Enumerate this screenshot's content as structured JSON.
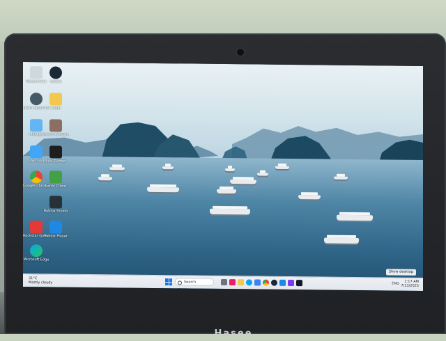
{
  "brand": "Hasee",
  "desktop_icons": [
    {
      "label": "Recycle Bin",
      "icon": "recycle-bin-icon",
      "color": "#cfd8dc"
    },
    {
      "label": "Steam",
      "icon": "steam-icon",
      "color": "#1b2838"
    },
    {
      "label": "Learn about this picture",
      "icon": "camera-icon",
      "color": "#455a64"
    },
    {
      "label": "Folder",
      "icon": "folder-icon",
      "color": "#f2c94c"
    },
    {
      "label": "Manage",
      "icon": "monitor-icon",
      "color": "#64b5f6"
    },
    {
      "label": "Where Winds Meet",
      "icon": "game-icon",
      "color": "#8d6e63"
    },
    {
      "label": "Downloads",
      "icon": "download-icon",
      "color": "#42a5f5"
    },
    {
      "label": "Epic Games",
      "icon": "epic-games-icon",
      "color": "#1e1e1e"
    },
    {
      "label": "Google Chrome",
      "icon": "chrome-icon",
      "color": "#ea4335"
    },
    {
      "label": "Lunar Client",
      "icon": "app-icon",
      "color": "#43a047"
    },
    {
      "label": "Roblox Studio",
      "icon": "roblox-studio-icon",
      "color": "#263238"
    },
    {
      "label": "Rockstar Games",
      "icon": "rockstar-icon",
      "color": "#e53935"
    },
    {
      "label": "Roblox Player",
      "icon": "roblox-icon",
      "color": "#1e88e5"
    },
    {
      "label": "Microsoft Edge",
      "icon": "edge-icon",
      "color": "#0ea5e9"
    }
  ],
  "taskbar": {
    "weather": "31°C\nMostly cloudy",
    "search_placeholder": "Search",
    "clock_time": "2:17 AM",
    "clock_date": "7/13/2025",
    "tray_lang": "ENG"
  },
  "show_desktop_label": "Show desktop"
}
